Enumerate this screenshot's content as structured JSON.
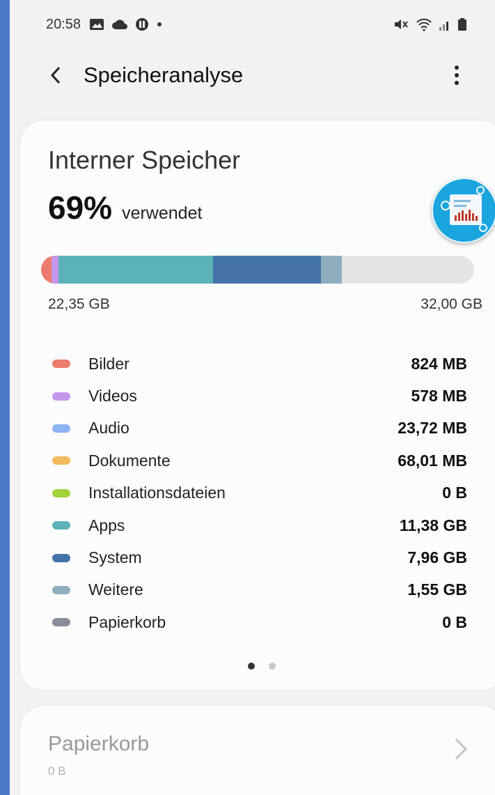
{
  "status_bar": {
    "time": "20:58"
  },
  "appbar": {
    "title": "Speicheranalyse"
  },
  "storage_card": {
    "title": "Interner Speicher",
    "used_percent": "69%",
    "used_label": "verwendet",
    "used_amount": "22,35 GB",
    "total_amount": "32,00 GB",
    "bar_fill_fraction": 0.69
  },
  "legend": [
    {
      "label": "Bilder",
      "value": "824 MB",
      "color": "#ee7a6e"
    },
    {
      "label": "Videos",
      "value": "578 MB",
      "color": "#c596ea"
    },
    {
      "label": "Audio",
      "value": "23,72 MB",
      "color": "#8cb4f4"
    },
    {
      "label": "Dokumente",
      "value": "68,01 MB",
      "color": "#f2bc5e"
    },
    {
      "label": "Installationsdateien",
      "value": "0 B",
      "color": "#a2d43e"
    },
    {
      "label": "Apps",
      "value": "11,38 GB",
      "color": "#5bb2b8"
    },
    {
      "label": "System",
      "value": "7,96 GB",
      "color": "#4372a8"
    },
    {
      "label": "Weitere",
      "value": "1,55 GB",
      "color": "#8eaec0"
    },
    {
      "label": "Papierkorb",
      "value": "0 B",
      "color": "#8b8c9a"
    }
  ],
  "pager": {
    "pages": 2,
    "active": 0
  },
  "trash_card": {
    "title": "Papierkorb",
    "subtitle": "0 B"
  }
}
